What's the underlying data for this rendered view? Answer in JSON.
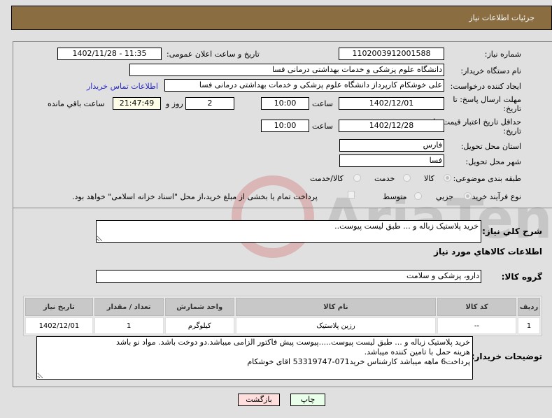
{
  "header": {
    "title": "جزئیات اطلاعات نیاز"
  },
  "fields": {
    "need_number": {
      "label": "شماره نیاز:",
      "value": "1102003912001588"
    },
    "announce_datetime": {
      "label": "تاریخ و ساعت اعلان عمومی:",
      "value": "1402/11/28 - 11:35"
    },
    "buyer_org": {
      "label": "نام دستگاه خریدار:",
      "value": "دانشگاه علوم پزشکی و خدمات بهداشتی درمانی فسا"
    },
    "requester": {
      "label": "ایجاد کننده درخواست:",
      "value": "علی خوشکام کارپرداز دانشگاه علوم پزشکی و خدمات بهداشتی درمانی فسا",
      "contact_link": "اطلاعات تماس خریدار"
    },
    "reply_deadline": {
      "label": "مهلت ارسال پاسخ: تا تاریخ:",
      "date": "1402/12/01",
      "time_label": "ساعت",
      "time": "10:00",
      "days": "2",
      "days_label": "روز و",
      "remaining": "21:47:49",
      "remaining_label": "ساعت باقي مانده"
    },
    "price_validity": {
      "label": "حداقل تاریخ اعتبار قیمت: تا تاریخ:",
      "date": "1402/12/28",
      "time_label": "ساعت",
      "time": "10:00"
    },
    "province": {
      "label": "استان محل تحویل:",
      "value": "فارس"
    },
    "city": {
      "label": "شهر محل تحویل:",
      "value": "فسا"
    },
    "category": {
      "label": "طبقه بندی موضوعی:",
      "options": [
        "کالا",
        "خدمت",
        "کالا/خدمت"
      ],
      "selected": "کالا"
    },
    "purchase_type": {
      "label": "نوع فرآیند خرید :",
      "options": [
        "جزیي",
        "متوسط"
      ],
      "selected": "جزیي",
      "checkbox_label": "پرداخت تمام یا بخشی از مبلغ خرید،از محل \"اسناد خزانه اسلامی\" خواهد بود.",
      "checkbox_checked": false
    }
  },
  "description": {
    "label": "شرح کلي نياز:",
    "value": "خرید پلاستیک زباله و ... طبق لیست پیوست.."
  },
  "goods_section": {
    "title": "اطلاعات کالاهاي مورد نياز",
    "group_label": "گروه کالا:",
    "group_value": "دارو، پزشکی و سلامت"
  },
  "table": {
    "headers": [
      "ردیف",
      "کد کالا",
      "نام کالا",
      "واحد شمارش",
      "تعداد / مقدار",
      "تاریخ نیاز"
    ],
    "rows": [
      [
        "1",
        "--",
        "رزین پلاستیک",
        "کیلوگرم",
        "1",
        "1402/12/01"
      ]
    ]
  },
  "buyer_notes": {
    "label": "توضیحات خریدار:",
    "value": "خرید پلاستیک زباله و ... طبق لیست پیوست.....پیوست پیش فاکتور الزامی میباشد.دو دوخت باشد. مواد نو باشد\nهزینه حمل با تامین کننده میباشد.\nپرداخت6 ماهه میباشد کارشناس خرید071-53319747 اقای خوشکام"
  },
  "buttons": {
    "print": "چاپ",
    "back": "بازگشت"
  },
  "colors": {
    "header_bg": "#8b6d42",
    "print_bg": "#eaffea",
    "back_bg": "#ffdede",
    "link": "#2525c8"
  }
}
